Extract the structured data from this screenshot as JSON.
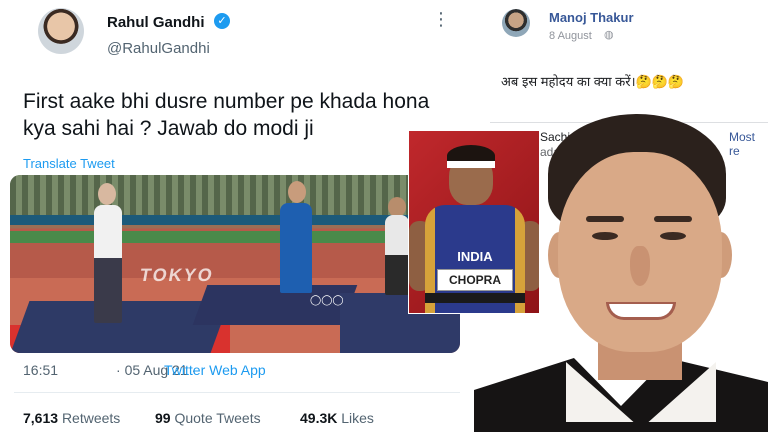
{
  "tweet": {
    "display_name": "Rahul Gandhi",
    "handle": "@RahulGandhi",
    "text": "First aake bhi dusre number pe khada hona kya sahi hai ? Jawab do modi ji",
    "translate_label": "Translate Tweet",
    "time": "16:51",
    "date": "05 Aug 21",
    "app": "Twitter Web App",
    "photo_text": "TOKYO",
    "stats": {
      "retweets_count": "7,613",
      "retweets_label": "Retweets",
      "quotes_count": "99",
      "quotes_label": "Quote Tweets",
      "likes_count": "49.3K",
      "likes_label": "Likes"
    }
  },
  "facebook_post": {
    "author": "Manoj Thakur",
    "date": "8 August",
    "text": "अब इस महोदय का क्या करें।🤔🤔🤔",
    "comment_author": "Sachin",
    "comment_meta": "aday",
    "most_relevant": "Most re"
  },
  "athlete_photo": {
    "country": "INDIA",
    "bib": "CHOPRA"
  },
  "colors": {
    "twitter_blue": "#1d9bf0",
    "facebook_blue": "#385898",
    "muted_text": "#536471"
  }
}
